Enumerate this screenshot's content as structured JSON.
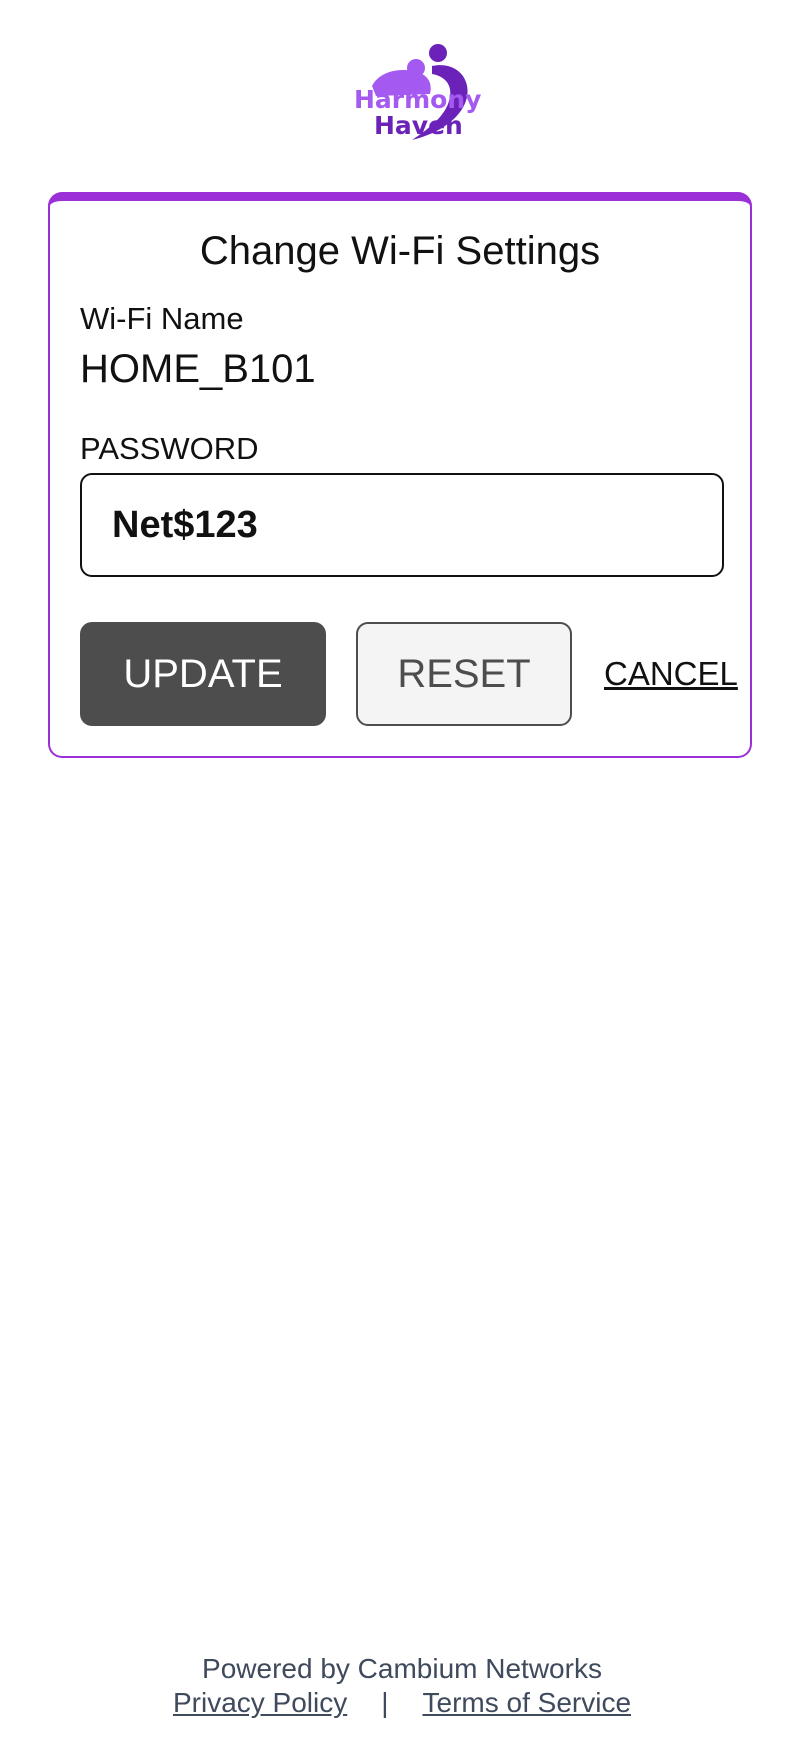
{
  "brand": {
    "line1": "Harmony",
    "line2": "Haven",
    "colors": {
      "light_purple": "#a45af0",
      "dark_purple": "#6b22b8"
    }
  },
  "card": {
    "title": "Change Wi-Fi Settings",
    "accent_color": "#9b30d9",
    "wifi_name_label": "Wi-Fi Name",
    "wifi_name_value": "HOME_B101",
    "password_label": "PASSWORD",
    "password_value": "Net$123",
    "update_label": "UPDATE",
    "reset_label": "RESET",
    "cancel_label": "CANCEL"
  },
  "footer": {
    "powered_by": "Powered by Cambium Networks",
    "privacy_label": "Privacy Policy",
    "separator": "|",
    "terms_label": "Terms of Service"
  }
}
